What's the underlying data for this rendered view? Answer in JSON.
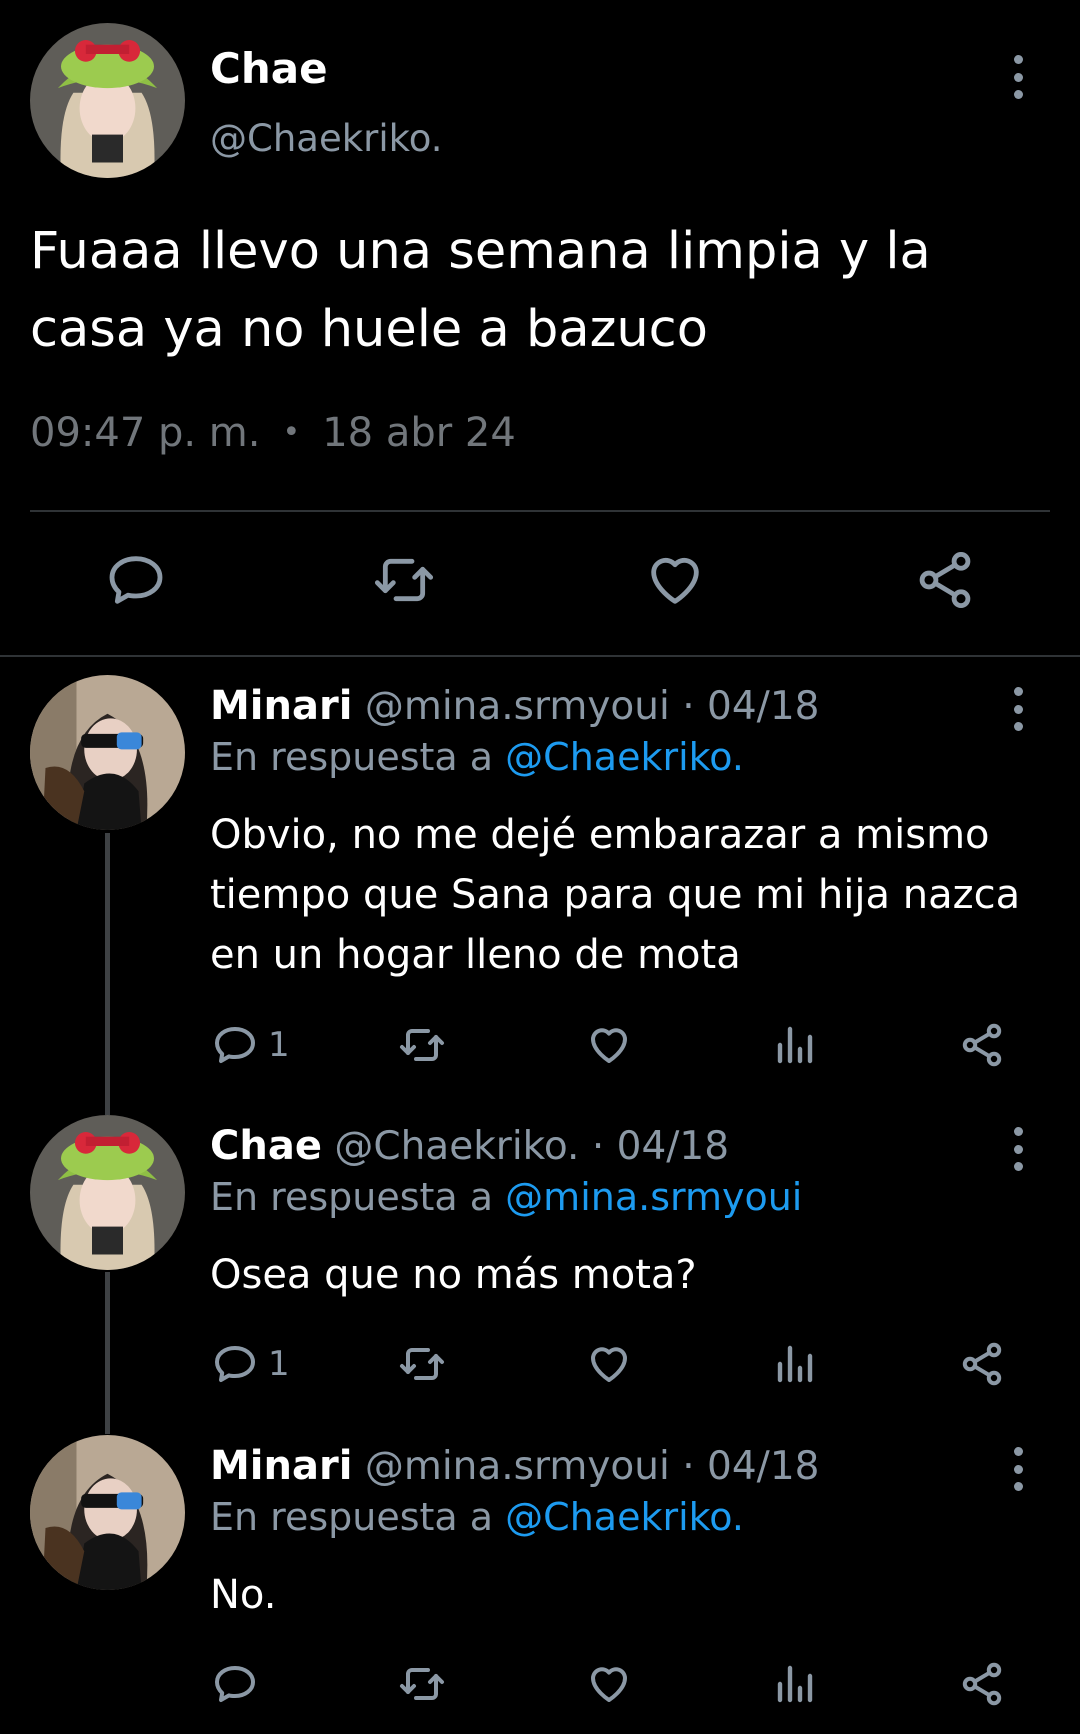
{
  "main_tweet": {
    "name": "Chae",
    "handle": "@Chaekriko.",
    "text": "Fuaaa llevo una semana limpia y la casa ya no huele a bazuco",
    "time": "09:47 p. m.",
    "separator": "•",
    "date": "18 abr 24",
    "actions": [
      "reply-icon",
      "retweet-icon",
      "like-icon",
      "share-icon"
    ]
  },
  "replies": [
    {
      "name": "Minari",
      "handle": "@mina.srmyoui",
      "separator": "·",
      "date": "04/18",
      "reply_prefix": "En respuesta a",
      "reply_to": "@Chaekriko.",
      "text": "Obvio, no me dejé embarazar a mismo tiempo que Sana para que mi hija nazca en un hogar lleno de mota",
      "reply_count": "1"
    },
    {
      "name": "Chae",
      "handle": "@Chaekriko.",
      "separator": "·",
      "date": "04/18",
      "reply_prefix": "En respuesta a",
      "reply_to": "@mina.srmyoui",
      "text": "Osea que no más mota?",
      "reply_count": "1"
    },
    {
      "name": "Minari",
      "handle": "@mina.srmyoui",
      "separator": "·",
      "date": "04/18",
      "reply_prefix": "En respuesta a",
      "reply_to": "@Chaekriko.",
      "text": "No.",
      "reply_count": ""
    }
  ],
  "colors": {
    "background": "#000000",
    "text": "#e7e9ea",
    "secondary": "#8b98a5",
    "mention": "#1d9bf0",
    "divider": "#2f3336"
  }
}
